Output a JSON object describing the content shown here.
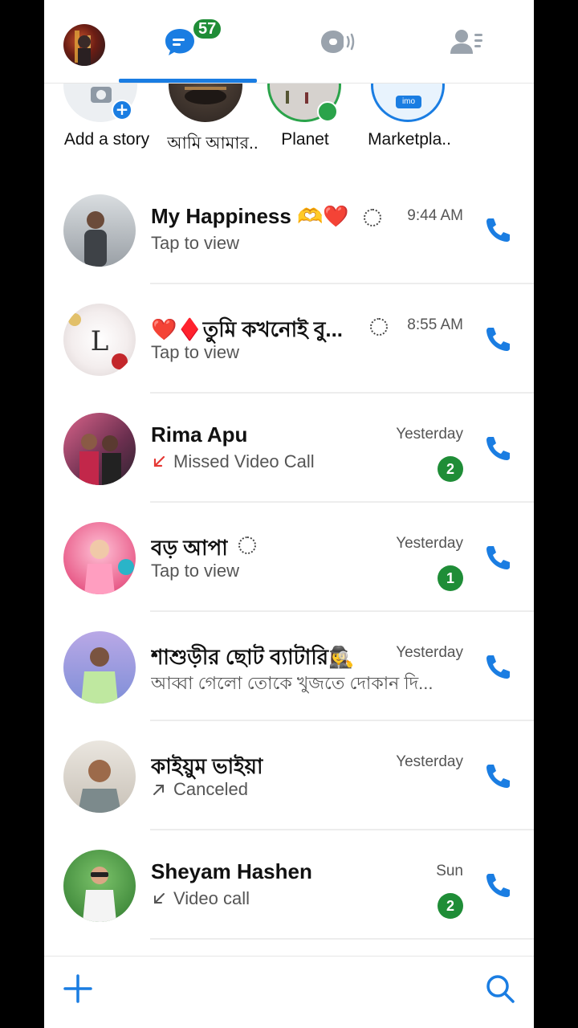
{
  "header": {
    "unread_badge": "57",
    "accent_color": "#1a7de2",
    "badge_color": "#1f8d37"
  },
  "stories": [
    {
      "label": "Add a story"
    },
    {
      "label": "আমি আমার.."
    },
    {
      "label": "Planet"
    },
    {
      "label": "Marketpla.."
    }
  ],
  "stories_marketplace_logo": "imo",
  "chats": [
    {
      "name": "My Happiness",
      "emoji": "🫶❤️",
      "subtitle": "Tap to view",
      "time": "9:44 AM",
      "unread": "",
      "status_icon": "ring"
    },
    {
      "name": "❤️♦️তুমি কখনোই বু...",
      "emoji": "",
      "subtitle": "Tap to view",
      "time": "8:55 AM",
      "unread": "",
      "status_icon": "ring"
    },
    {
      "name": "Rima Apu",
      "emoji": "",
      "subtitle": "Missed Video Call",
      "time": "Yesterday",
      "unread": "2",
      "status_icon": "missed-arrow"
    },
    {
      "name": "বড় আপা",
      "emoji": "",
      "subtitle": "Tap to view",
      "time": "Yesterday",
      "unread": "1",
      "status_icon": "ring"
    },
    {
      "name": "শাশুড়ীর ছোট ব্যাটারি🕵️‍♀️",
      "emoji": "",
      "subtitle": "আব্বা গেলো তোকে খুজতে দোকান দি...",
      "time": "Yesterday",
      "unread": "",
      "status_icon": "none"
    },
    {
      "name": "কাইয়ুম ভাইয়া",
      "emoji": "",
      "subtitle": "Canceled",
      "time": "Yesterday",
      "unread": "",
      "status_icon": "outgoing-arrow"
    },
    {
      "name": "Sheyam Hashen",
      "emoji": "",
      "subtitle": "Video call",
      "time": "Sun",
      "unread": "2",
      "status_icon": "incoming-arrow"
    }
  ]
}
